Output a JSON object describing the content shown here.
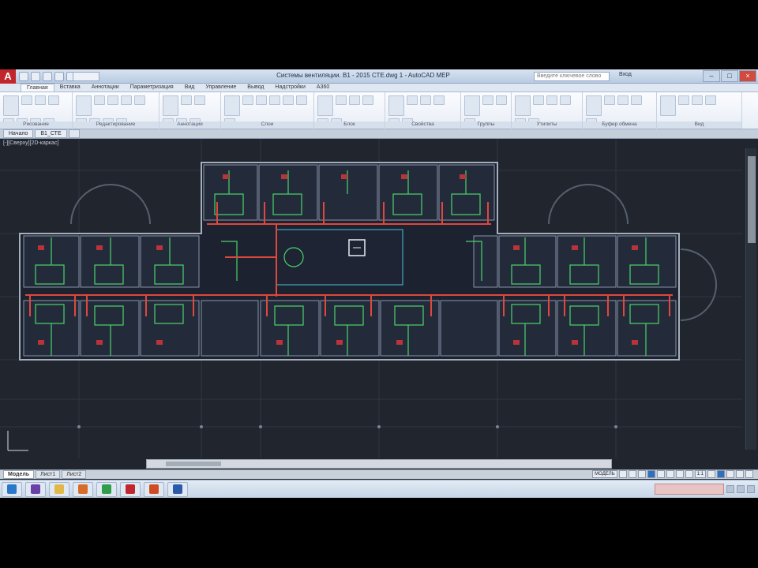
{
  "app": {
    "logo": "A",
    "window_title": "Системы вентиляции. В1 - 2015 СТЕ.dwg 1 - AutoCAD MEP",
    "search_placeholder": "Введите ключевое слово",
    "signin_label": "Вход"
  },
  "ribbon": {
    "tabs": [
      "Главная",
      "Вставка",
      "Аннотации",
      "Параметризация",
      "Вид",
      "Управление",
      "Вывод",
      "Надстройки",
      "A360"
    ],
    "active_tab": 0,
    "panels": [
      {
        "title": "Рисование",
        "tools": 8
      },
      {
        "title": "Редактирование",
        "tools": 9
      },
      {
        "title": "Аннотации",
        "tools": 6
      },
      {
        "title": "Слои",
        "tools": 7
      },
      {
        "title": "Блок",
        "tools": 6
      },
      {
        "title": "Свойства",
        "tools": 6
      },
      {
        "title": "Группы",
        "tools": 4
      },
      {
        "title": "Утилиты",
        "tools": 6
      },
      {
        "title": "Буфер обмена",
        "tools": 5
      },
      {
        "title": "Вид",
        "tools": 4
      }
    ]
  },
  "file_tabs": [
    {
      "label": "Начало"
    },
    {
      "label": "В1_СТЕ"
    }
  ],
  "viewport": {
    "label": "[-][Сверху][2D-каркас]"
  },
  "layout_tabs": [
    {
      "label": "Модель",
      "active": true
    },
    {
      "label": "Лист1",
      "active": false
    },
    {
      "label": "Лист2",
      "active": false
    }
  ],
  "status": {
    "model_label": "МОДЕЛЬ",
    "scale": "1:1"
  },
  "taskbar": {
    "items": [
      {
        "icon": "windows-icon",
        "color": "#2a78c8"
      },
      {
        "icon": "visual-studio-icon",
        "color": "#6a3fa8"
      },
      {
        "icon": "folder-icon",
        "color": "#e0b84a"
      },
      {
        "icon": "app-icon",
        "color": "#d66b2a"
      },
      {
        "icon": "chrome-icon",
        "color": "#2f9e4b"
      },
      {
        "icon": "autocad-icon",
        "color": "#c0262c"
      },
      {
        "icon": "powerpoint-icon",
        "color": "#d04b23"
      },
      {
        "icon": "word-icon",
        "color": "#2b5aa8"
      }
    ]
  },
  "colors": {
    "canvas": "#20252e",
    "walls": "#9aa4b2",
    "ducts": "#e0473d",
    "fixtures": "#4bd36a",
    "accent_cyan": "#46c6e0"
  }
}
